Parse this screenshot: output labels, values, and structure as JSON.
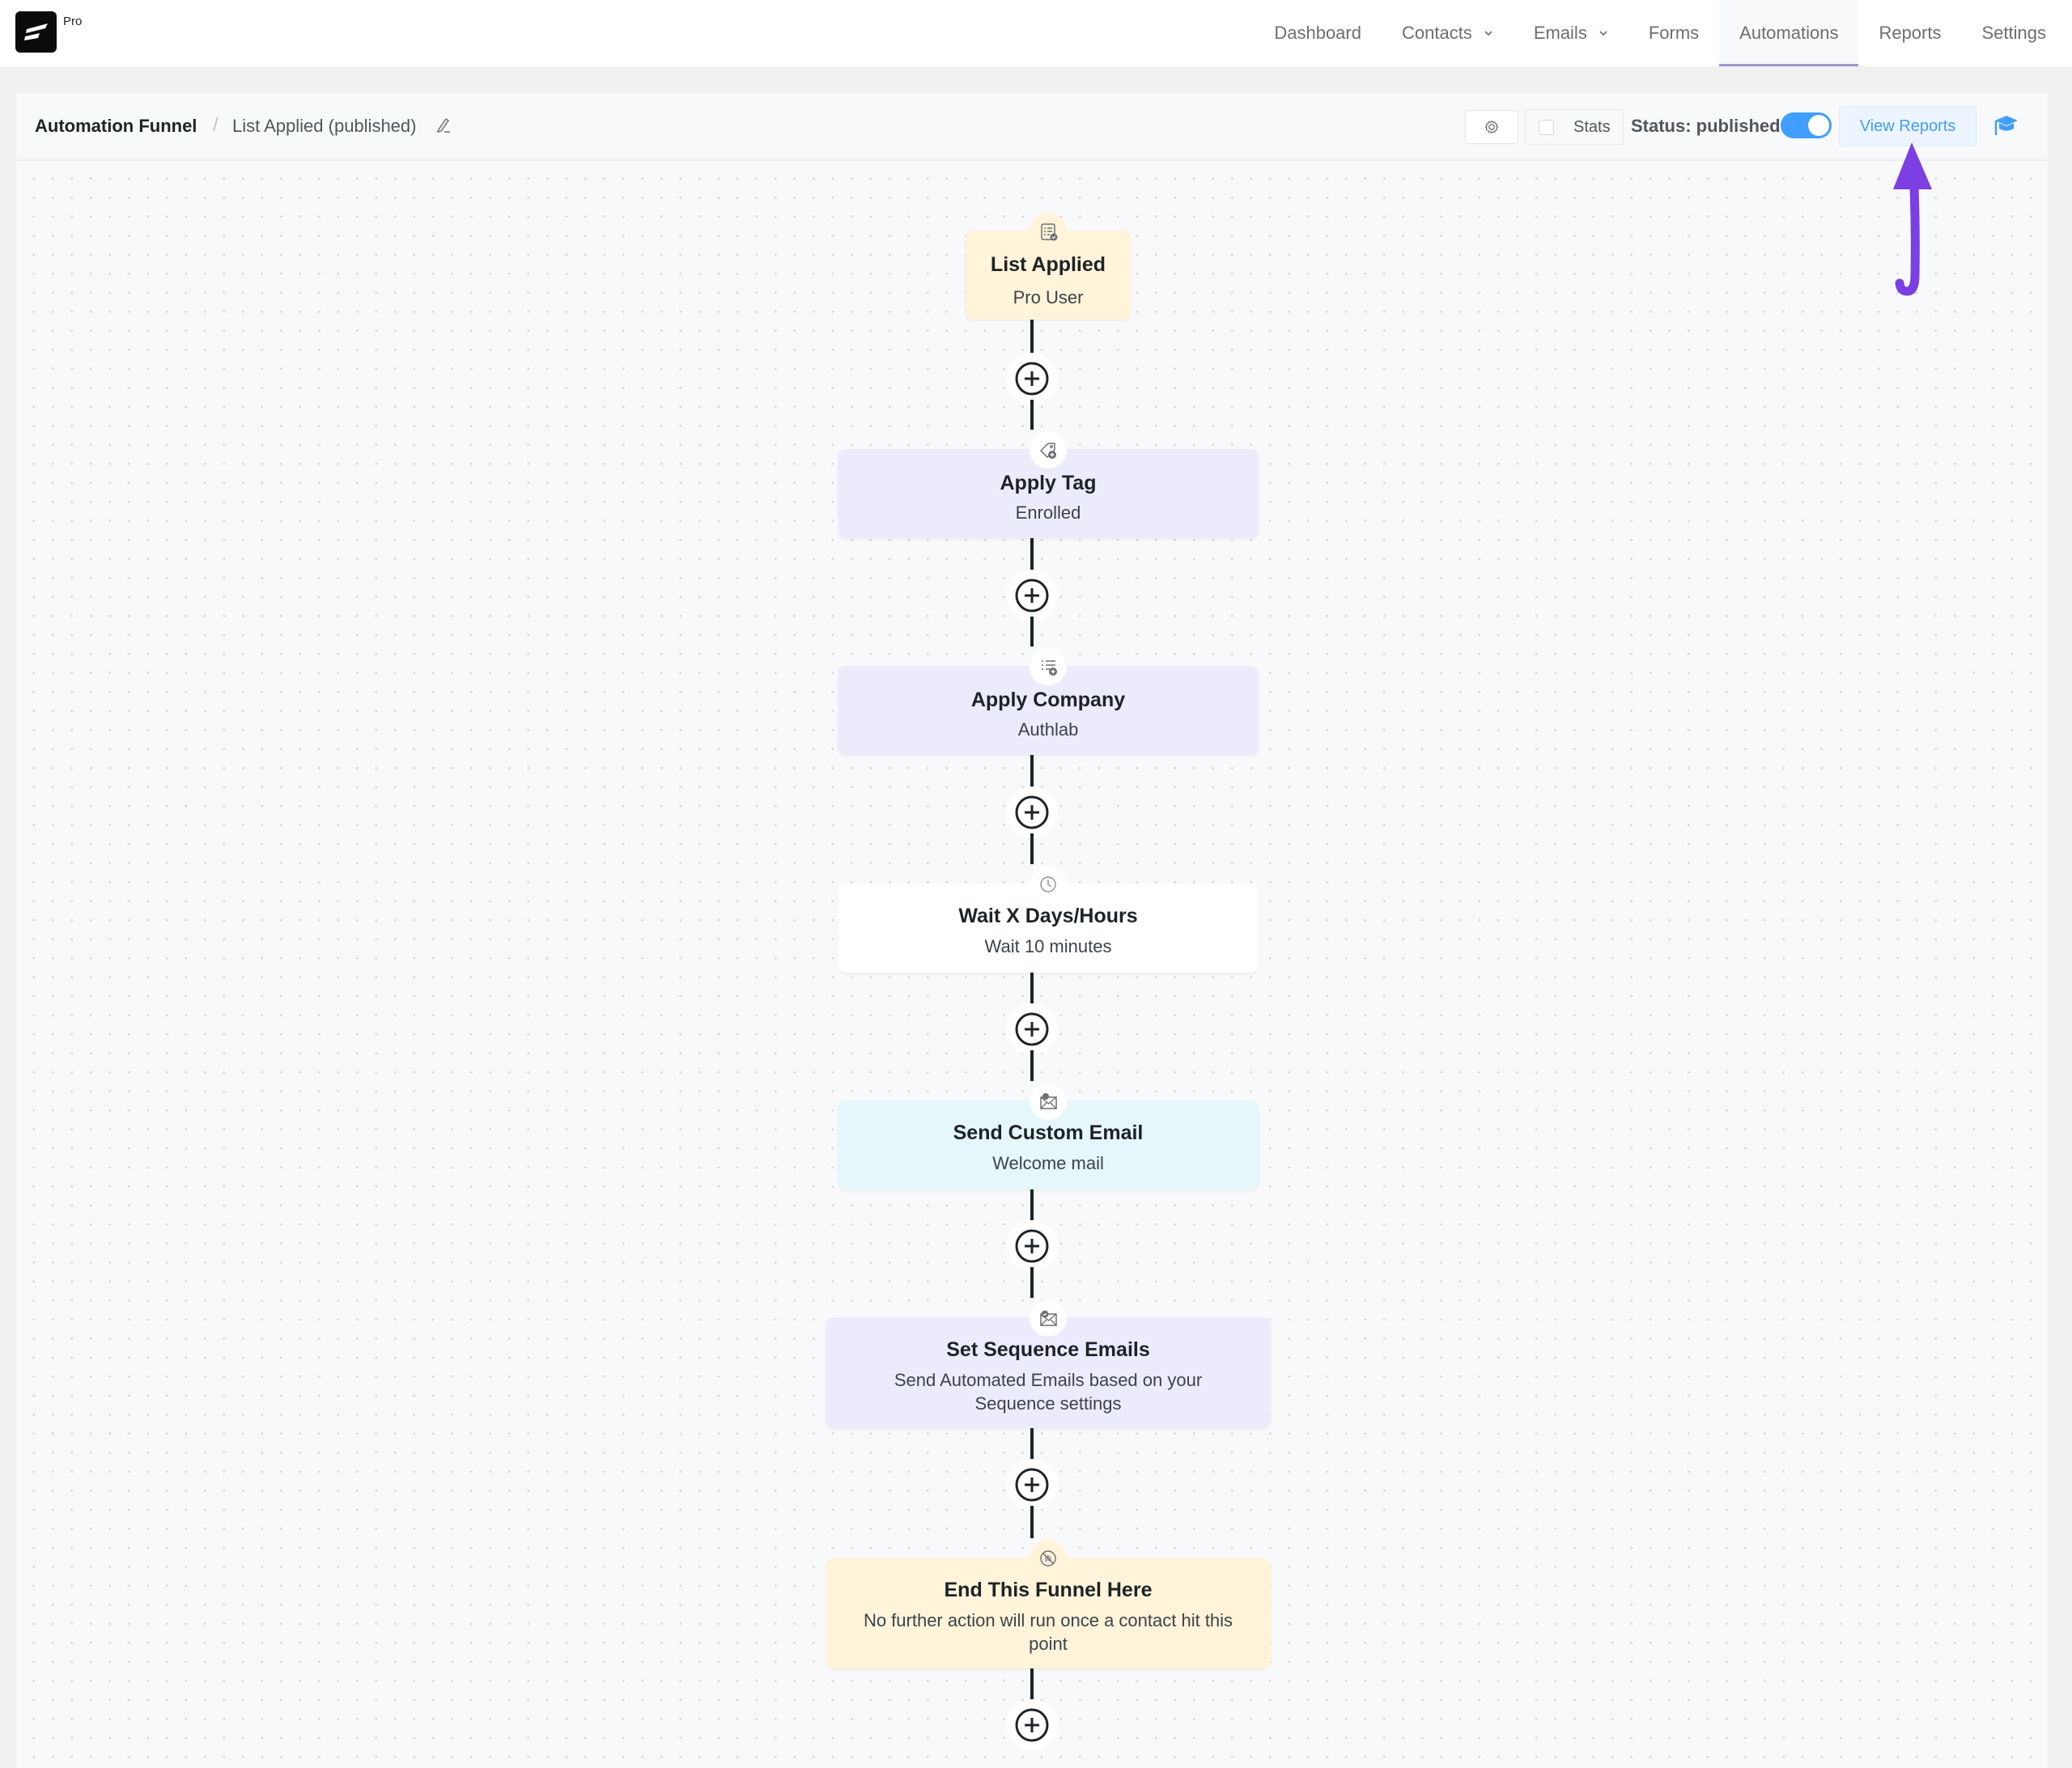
{
  "app": {
    "logo_badge": "Pro"
  },
  "nav": {
    "items": [
      {
        "label": "Dashboard",
        "has_dropdown": false,
        "active": false
      },
      {
        "label": "Contacts",
        "has_dropdown": true,
        "active": false
      },
      {
        "label": "Emails",
        "has_dropdown": true,
        "active": false
      },
      {
        "label": "Forms",
        "has_dropdown": false,
        "active": false
      },
      {
        "label": "Automations",
        "has_dropdown": false,
        "active": true
      },
      {
        "label": "Reports",
        "has_dropdown": false,
        "active": false
      },
      {
        "label": "Settings",
        "has_dropdown": false,
        "active": false
      }
    ]
  },
  "header": {
    "breadcrumb_root": "Automation Funnel",
    "breadcrumb_separator": "/",
    "breadcrumb_current": "List Applied (published)",
    "stats_label": "Stats",
    "stats_checked": false,
    "status_label": "Status: published",
    "status_enabled": true,
    "view_reports_label": "View Reports",
    "accent_color": "#409eff"
  },
  "annotation": {
    "color": "#7b3fe4",
    "points_to": "View Reports"
  },
  "funnel": {
    "nodes": [
      {
        "icon": "list-check-icon",
        "title": "List Applied",
        "subtitle": "Pro User",
        "type": "trigger"
      },
      {
        "icon": "tag-add-icon",
        "title": "Apply Tag",
        "subtitle": "Enrolled",
        "type": "action"
      },
      {
        "icon": "list-add-icon",
        "title": "Apply Company",
        "subtitle": "Authlab",
        "type": "action"
      },
      {
        "icon": "clock-icon",
        "title": "Wait X Days/Hours",
        "subtitle": "Wait 10 minutes",
        "type": "timer"
      },
      {
        "icon": "email-send-icon",
        "title": "Send Custom Email",
        "subtitle": "Welcome mail",
        "type": "email"
      },
      {
        "icon": "email-check-icon",
        "title": "Set Sequence Emails",
        "subtitle": "Send Automated Emails based on your Sequence settings",
        "type": "action"
      },
      {
        "icon": "stop-hand-icon",
        "title": "End This Funnel Here",
        "subtitle": "No further action will run once a contact hit this point",
        "type": "end"
      }
    ],
    "add_step_count": 7
  }
}
